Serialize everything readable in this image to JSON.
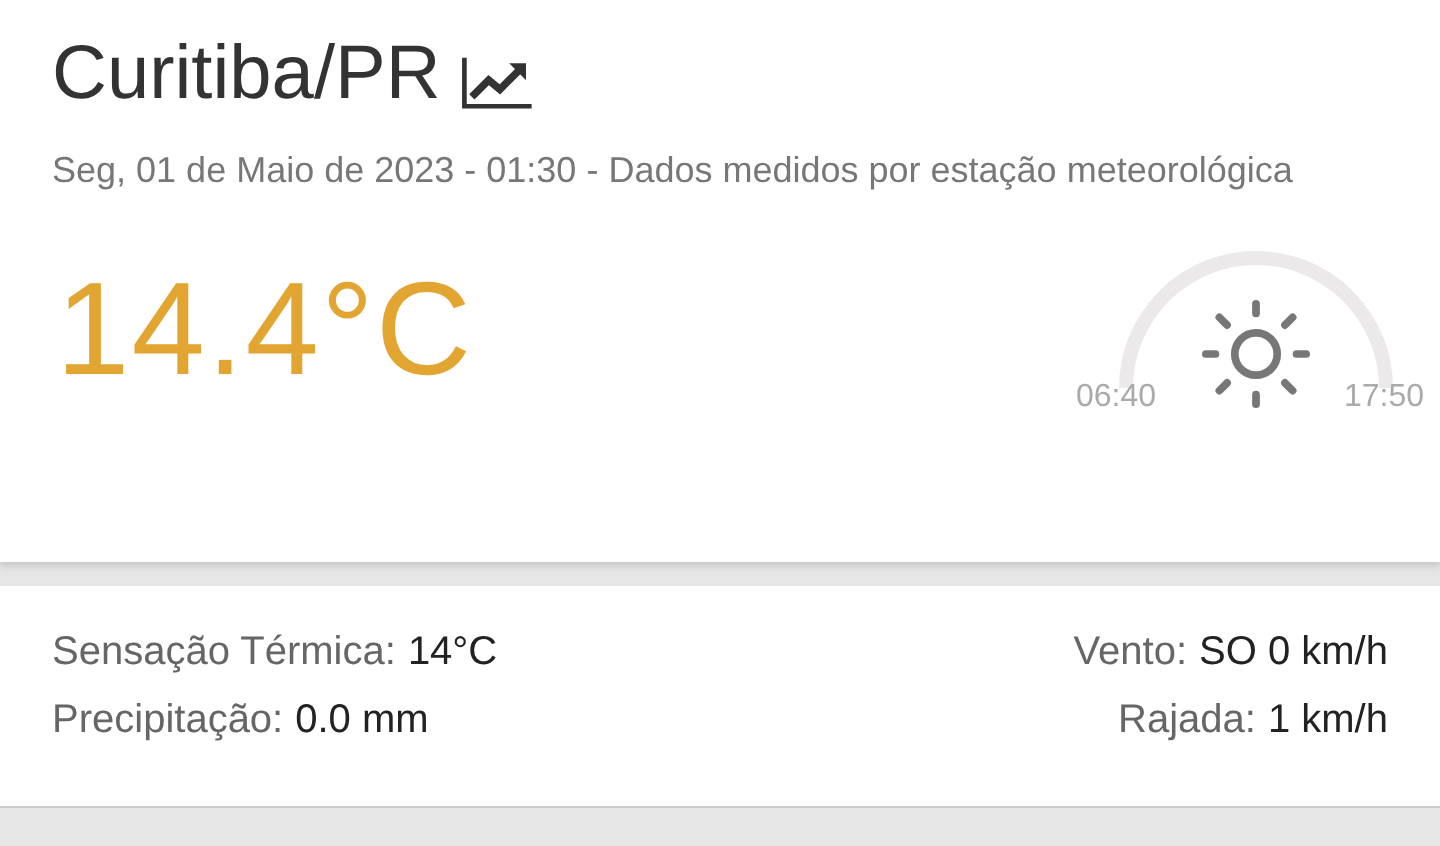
{
  "city": "Curitiba/PR",
  "subtitle": "Seg, 01 de Maio de 2023 - 01:30 - Dados medidos por estação meteorológica",
  "temperature": "14.4°C",
  "sun": {
    "sunrise": "06:40",
    "sunset": "17:50"
  },
  "details_left": [
    {
      "label": "Sensação Térmica:",
      "value": "14°C"
    },
    {
      "label": "Precipitação:",
      "value": "0.0 mm"
    }
  ],
  "details_right": [
    {
      "label": "Vento:",
      "value": "SO 0 km/h"
    },
    {
      "label": "Rajada:",
      "value": "1 km/h"
    }
  ]
}
